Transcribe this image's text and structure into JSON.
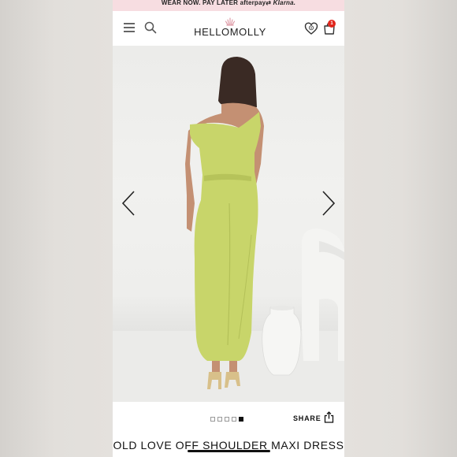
{
  "promo": {
    "text": "WEAR NOW. PAY LATER",
    "afterpay": "afterpay",
    "klarna": "Klarna."
  },
  "header": {
    "logo": "HELLOMOLLY",
    "cart_count": "1"
  },
  "icons": {
    "menu": "hamburger-menu-icon",
    "search": "search-icon",
    "wishlist": "heart-icon",
    "cart": "shopping-bag-icon",
    "prev": "chevron-left-icon",
    "next": "chevron-right-icon",
    "share": "share-icon"
  },
  "carousel": {
    "total": 5,
    "active": 5
  },
  "share_label": "SHARE",
  "product": {
    "title": "OLD LOVE OFF SHOULDER MAXI DRESS"
  },
  "colors": {
    "promo_bg": "#f7dde1",
    "badge": "#e1261c",
    "dress": "#c8d56a"
  }
}
